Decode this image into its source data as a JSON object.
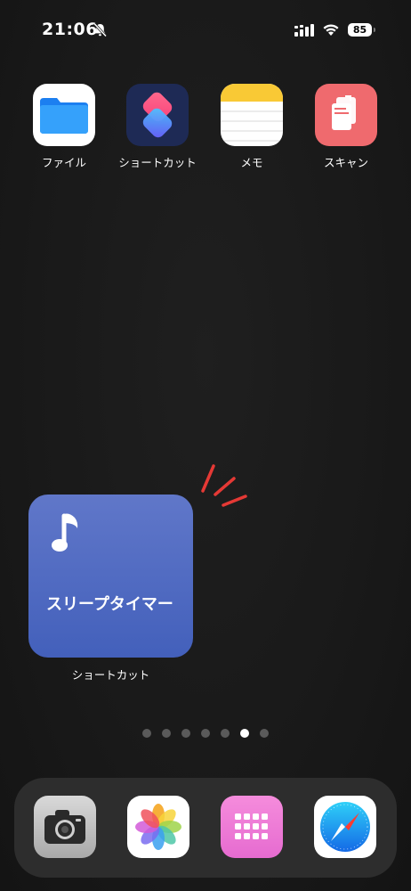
{
  "status_bar": {
    "time": "21:06",
    "battery": "85",
    "icons": [
      "bell-slash-icon",
      "cellular-signal-icon",
      "wifi-icon",
      "battery-icon"
    ]
  },
  "home_apps": [
    {
      "label": "ファイル",
      "icon": "folder-icon"
    },
    {
      "label": "ショートカット",
      "icon": "shortcuts-icon"
    },
    {
      "label": "メモ",
      "icon": "notes-icon"
    },
    {
      "label": "スキャン",
      "icon": "scan-documents-icon"
    }
  ],
  "widget": {
    "title": "スリープタイマー",
    "icon": "music-note-icon",
    "label": "ショートカット",
    "accent_color": "#4a66c2"
  },
  "page_dots": {
    "count": 7,
    "active_index": 5
  },
  "dock": {
    "apps": [
      {
        "icon": "camera-icon"
      },
      {
        "icon": "photos-icon"
      },
      {
        "icon": "app-grid-icon"
      },
      {
        "icon": "safari-icon"
      }
    ]
  },
  "colors": {
    "background": "#1a1a1a",
    "annotation_red": "#e53935",
    "dock": "#2d2d2d"
  }
}
